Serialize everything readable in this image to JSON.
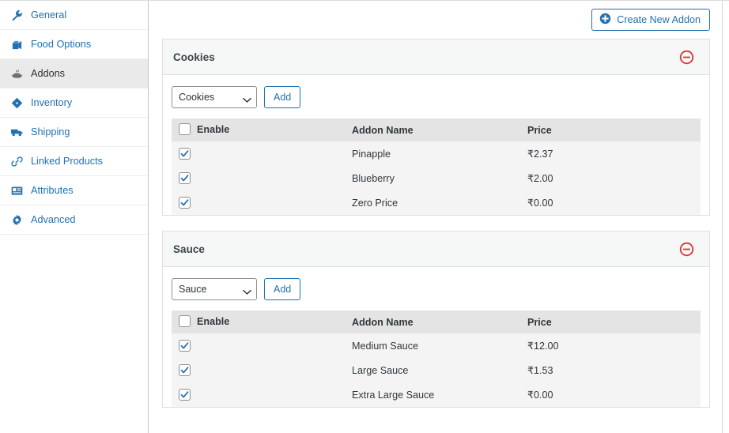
{
  "sidebar": {
    "items": [
      {
        "label": "General",
        "icon": "wrench-icon",
        "active": false
      },
      {
        "label": "Food Options",
        "icon": "food-box-icon",
        "active": false
      },
      {
        "label": "Addons",
        "icon": "bowl-icon",
        "active": true
      },
      {
        "label": "Inventory",
        "icon": "tag-icon",
        "active": false
      },
      {
        "label": "Shipping",
        "icon": "truck-icon",
        "active": false
      },
      {
        "label": "Linked Products",
        "icon": "link-icon",
        "active": false
      },
      {
        "label": "Attributes",
        "icon": "id-card-icon",
        "active": false
      },
      {
        "label": "Advanced",
        "icon": "gear-icon",
        "active": false
      }
    ]
  },
  "toolbar": {
    "create_label": "Create New Addon",
    "create_icon": "circle-plus-icon"
  },
  "colors": {
    "accent_blue": "#2271b1",
    "remove_red": "#d63638",
    "active_bg": "#eaeaea",
    "panel_head_bg": "#f6f7f7",
    "table_head_bg": "#e4e4e4",
    "table_row_bg": "#f4f4f4"
  },
  "table_headers": {
    "enable": "Enable",
    "name": "Addon Name",
    "price": "Price"
  },
  "add_label": "Add",
  "remove_icon": "circle-minus-icon",
  "panels": [
    {
      "title": "Cookies",
      "select_value": "Cookies",
      "select_options": [
        "Cookies"
      ],
      "header_checked": false,
      "rows": [
        {
          "enabled": true,
          "name": "Pinapple",
          "price": "₹2.37"
        },
        {
          "enabled": true,
          "name": "Blueberry",
          "price": "₹2.00"
        },
        {
          "enabled": true,
          "name": "Zero Price",
          "price": "₹0.00"
        }
      ]
    },
    {
      "title": "Sauce",
      "select_value": "Sauce",
      "select_options": [
        "Sauce"
      ],
      "header_checked": false,
      "rows": [
        {
          "enabled": true,
          "name": "Medium Sauce",
          "price": "₹12.00"
        },
        {
          "enabled": true,
          "name": "Large Sauce",
          "price": "₹1.53"
        },
        {
          "enabled": true,
          "name": "Extra Large Sauce",
          "price": "₹0.00"
        }
      ]
    }
  ]
}
